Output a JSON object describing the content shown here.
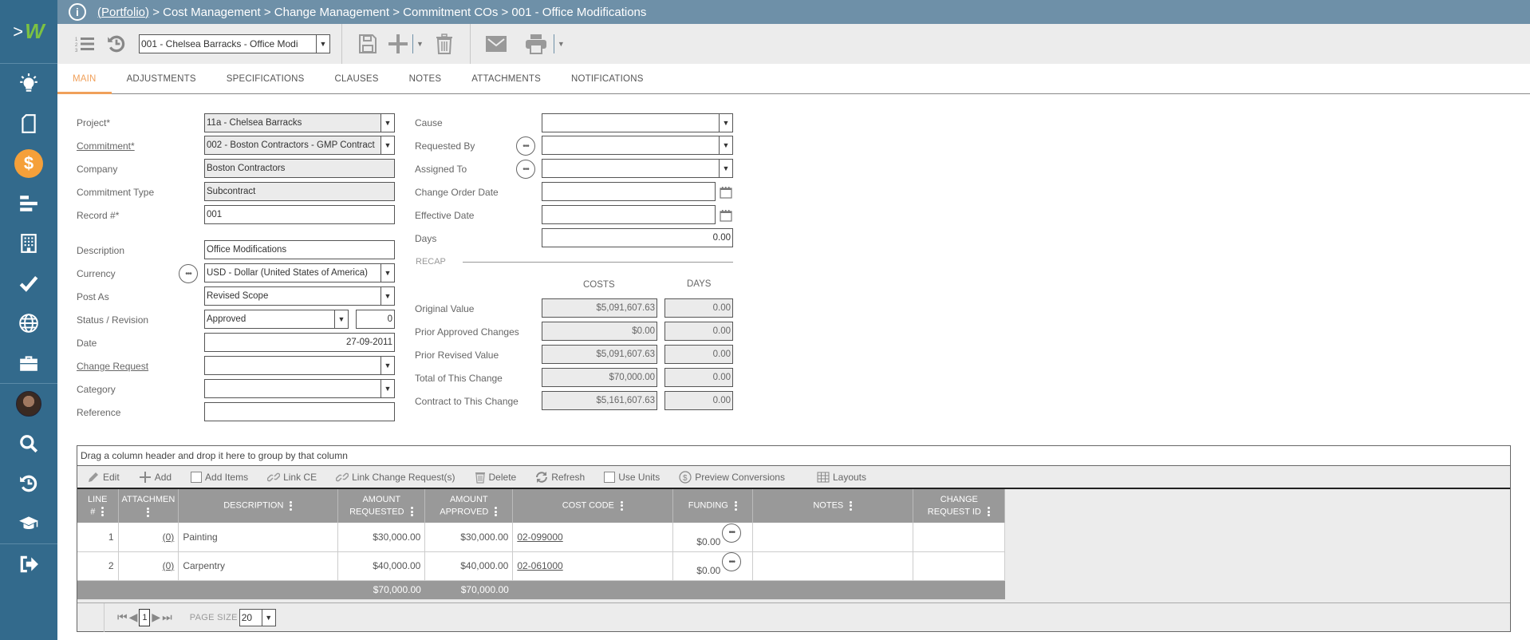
{
  "sidebar": {
    "logo_chevron": ">",
    "logo_mark": "W",
    "items": [
      {
        "name": "lightbulb-icon",
        "label": "Ideas"
      },
      {
        "name": "document-icon",
        "label": "Documents"
      },
      {
        "name": "dollar-icon",
        "label": "Cost Management",
        "active": true,
        "glyph": "$"
      },
      {
        "name": "gantt-icon",
        "label": "Schedule"
      },
      {
        "name": "building-icon",
        "label": "Buildings"
      },
      {
        "name": "checkmark-icon",
        "label": "Tasks"
      },
      {
        "name": "globe-icon",
        "label": "Portfolio"
      },
      {
        "name": "briefcase-icon",
        "label": "Projects"
      },
      {
        "name": "avatar",
        "label": "User"
      },
      {
        "name": "search-icon",
        "label": "Search"
      },
      {
        "name": "history-icon",
        "label": "Recent"
      },
      {
        "name": "graduation-cap-icon",
        "label": "Learning"
      },
      {
        "name": "logout-icon",
        "label": "Logout"
      }
    ],
    "active_color": "#f5a03a"
  },
  "titlebar": {
    "info_glyph": "i",
    "portfolio_link": "(Portfolio)",
    "path": " > Cost Management > Change Management > Commitment COs > 001 - Office Modifications"
  },
  "toolbar": {
    "record_select": "001 - Chelsea Barracks - Office Modi",
    "dropdown_glyph": "▼"
  },
  "tabs": [
    {
      "label": "MAIN",
      "active": true
    },
    {
      "label": "ADJUSTMENTS"
    },
    {
      "label": "SPECIFICATIONS"
    },
    {
      "label": "CLAUSES"
    },
    {
      "label": "NOTES"
    },
    {
      "label": "ATTACHMENTS"
    },
    {
      "label": "NOTIFICATIONS"
    }
  ],
  "form_left": {
    "project": {
      "label": "Project*",
      "value": "11a - Chelsea Barracks"
    },
    "commitment": {
      "label": "Commitment*",
      "value": "002 - Boston Contractors - GMP Contract"
    },
    "company": {
      "label": "Company",
      "value": "Boston Contractors"
    },
    "commitment_type": {
      "label": "Commitment Type",
      "value": "Subcontract"
    },
    "record": {
      "label": "Record #*",
      "value": "001"
    },
    "description": {
      "label": "Description",
      "value": "Office Modifications"
    },
    "currency": {
      "label": "Currency",
      "value": "USD - Dollar (United States of America)"
    },
    "post_as": {
      "label": "Post As",
      "value": "Revised Scope"
    },
    "status": {
      "label": "Status / Revision",
      "value": "Approved",
      "revision": "0"
    },
    "date": {
      "label": "Date",
      "value": "27-09-2011"
    },
    "change_request": {
      "label": "Change Request",
      "value": ""
    },
    "category": {
      "label": "Category",
      "value": ""
    },
    "reference": {
      "label": "Reference",
      "value": ""
    }
  },
  "form_right": {
    "cause": {
      "label": "Cause",
      "value": ""
    },
    "requested_by": {
      "label": "Requested By",
      "value": ""
    },
    "assigned_to": {
      "label": "Assigned To",
      "value": ""
    },
    "change_order_date": {
      "label": "Change Order Date",
      "value": ""
    },
    "effective_date": {
      "label": "Effective Date",
      "value": ""
    },
    "days": {
      "label": "Days",
      "value": "0.00"
    }
  },
  "recap": {
    "title": "RECAP",
    "col_costs": "COSTS",
    "col_days": "DAYS",
    "rows": [
      {
        "label": "Original Value",
        "cost": "$5,091,607.63",
        "days": "0.00"
      },
      {
        "label": "Prior Approved Changes",
        "cost": "$0.00",
        "days": "0.00"
      },
      {
        "label": "Prior Revised Value",
        "cost": "$5,091,607.63",
        "days": "0.00"
      },
      {
        "label": "Total of This Change",
        "cost": "$70,000.00",
        "days": "0.00"
      },
      {
        "label": "Contract to This Change",
        "cost": "$5,161,607.63",
        "days": "0.00"
      }
    ]
  },
  "grid": {
    "group_hint": "Drag a column header and drop it here to group by that column",
    "tools": {
      "edit": "Edit",
      "add": "Add",
      "add_items": "Add Items",
      "link_ce": "Link CE",
      "link_cr": "Link Change Request(s)",
      "delete": "Delete",
      "refresh": "Refresh",
      "use_units": "Use Units",
      "preview": "Preview Conversions",
      "layouts": "Layouts"
    },
    "columns": [
      {
        "l1": "LINE",
        "l2": "#"
      },
      {
        "l1": "ATTACHMEN",
        "l2": ""
      },
      {
        "l1": "DESCRIPTION",
        "l2": ""
      },
      {
        "l1": "AMOUNT",
        "l2": "REQUESTED"
      },
      {
        "l1": "AMOUNT",
        "l2": "APPROVED"
      },
      {
        "l1": "COST CODE",
        "l2": ""
      },
      {
        "l1": "FUNDING",
        "l2": ""
      },
      {
        "l1": "NOTES",
        "l2": ""
      },
      {
        "l1": "CHANGE",
        "l2": "REQUEST ID"
      }
    ],
    "rows": [
      {
        "line": "1",
        "attach": "(0)",
        "desc": "Painting",
        "req": "$30,000.00",
        "appr": "$30,000.00",
        "code": "02-099000",
        "funding": "$0.00",
        "notes": "",
        "crid": ""
      },
      {
        "line": "2",
        "attach": "(0)",
        "desc": "Carpentry",
        "req": "$40,000.00",
        "appr": "$40,000.00",
        "code": "02-061000",
        "funding": "$0.00",
        "notes": "",
        "crid": ""
      }
    ],
    "totals": {
      "req": "$70,000.00",
      "appr": "$70,000.00"
    },
    "pager": {
      "current": "1",
      "page_size_label": "PAGE SIZE",
      "page_size": "20"
    }
  }
}
